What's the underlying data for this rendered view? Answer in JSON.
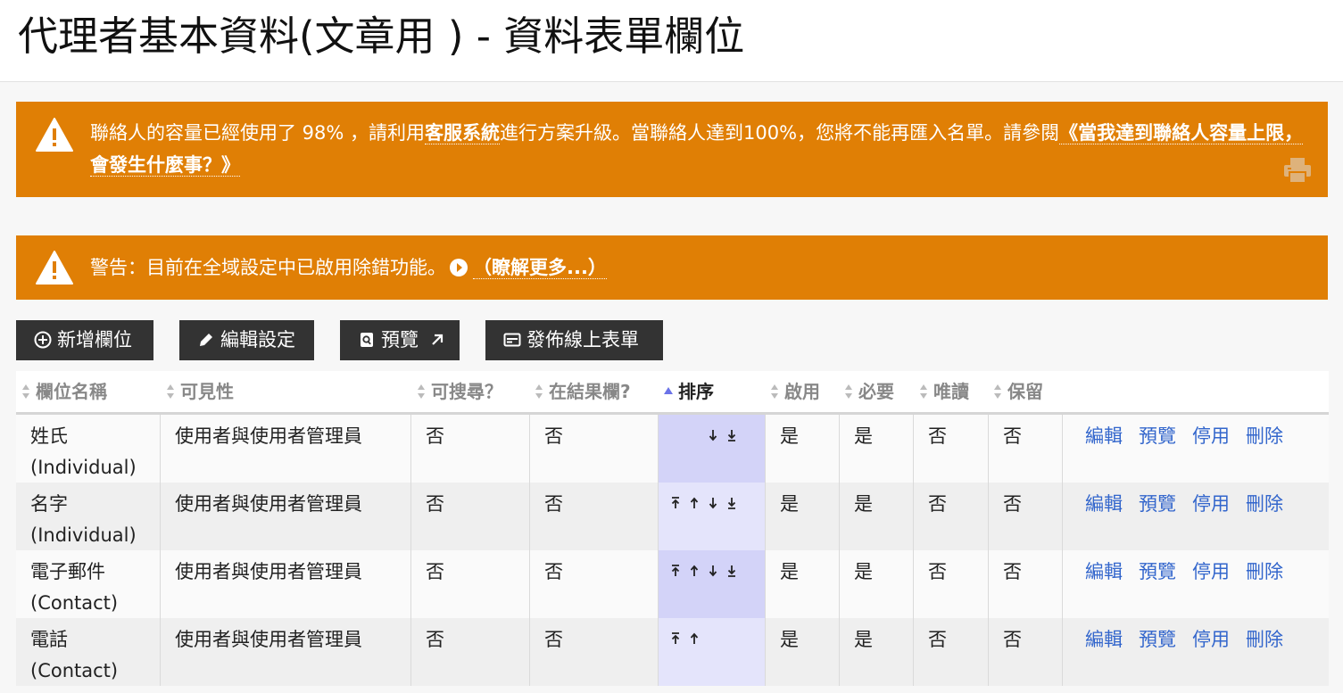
{
  "page": {
    "title": "代理者基本資料(文章用 )  - 資料表單欄位"
  },
  "alerts": {
    "capacity": {
      "text_before": "聯絡人的容量已經使用了 98% ，請利用",
      "link_support": "客服系統",
      "text_middle": "進行方案升級。當聯絡人達到100%，您將不能再匯入名單。請參閱",
      "link_faq": "《當我達到聯絡人容量上限，會發生什麼事？》"
    },
    "debug": {
      "text": "警告：目前在全域設定中已啟用除錯功能。",
      "link": "（瞭解更多...）"
    }
  },
  "toolbar": {
    "add_field": "新增欄位",
    "edit_settings": "編輯設定",
    "preview": "預覽",
    "publish": "發佈線上表單"
  },
  "table": {
    "headers": {
      "name": "欄位名稱",
      "visibility": "可見性",
      "searchable": "可搜尋？",
      "in_results": "在結果欄?",
      "order": "排序",
      "enabled": "啟用",
      "required": "必要",
      "readonly": "唯讀",
      "reserved": "保留"
    },
    "rows": [
      {
        "name_line1": "姓氏",
        "name_line2": "(Individual)",
        "visibility": "使用者與使用者管理員",
        "searchable": "否",
        "in_results": "否",
        "enabled": "是",
        "required": "是",
        "readonly": "否",
        "reserved": "否",
        "order_controls": [
          "move-down",
          "move-bottom"
        ]
      },
      {
        "name_line1": "名字",
        "name_line2": "(Individual)",
        "visibility": "使用者與使用者管理員",
        "searchable": "否",
        "in_results": "否",
        "enabled": "是",
        "required": "是",
        "readonly": "否",
        "reserved": "否",
        "order_controls": [
          "move-top",
          "move-up",
          "move-down",
          "move-bottom"
        ]
      },
      {
        "name_line1": "電子郵件",
        "name_line2": "(Contact)",
        "visibility": "使用者與使用者管理員",
        "searchable": "否",
        "in_results": "否",
        "enabled": "是",
        "required": "是",
        "readonly": "否",
        "reserved": "否",
        "order_controls": [
          "move-top",
          "move-up",
          "move-down",
          "move-bottom"
        ]
      },
      {
        "name_line1": "電話",
        "name_line2": "(Contact)",
        "visibility": "使用者與使用者管理員",
        "searchable": "否",
        "in_results": "否",
        "enabled": "是",
        "required": "是",
        "readonly": "否",
        "reserved": "否",
        "order_controls": [
          "move-top",
          "move-up"
        ]
      }
    ],
    "actions": {
      "edit": "編輯",
      "preview": "預覽",
      "disable": "停用",
      "delete": "刪除"
    }
  },
  "colors": {
    "alert_bg": "#e07f05",
    "button_bg": "#333333",
    "link": "#3366cc",
    "sort_col": "#d3d3f8"
  },
  "icons": {
    "alert": "warning-triangle-icon",
    "print": "printer-icon",
    "add": "plus-circle-icon",
    "edit": "pencil-icon",
    "preview": "magnifier-doc-icon",
    "external": "external-arrow-icon",
    "publish": "form-icon"
  }
}
